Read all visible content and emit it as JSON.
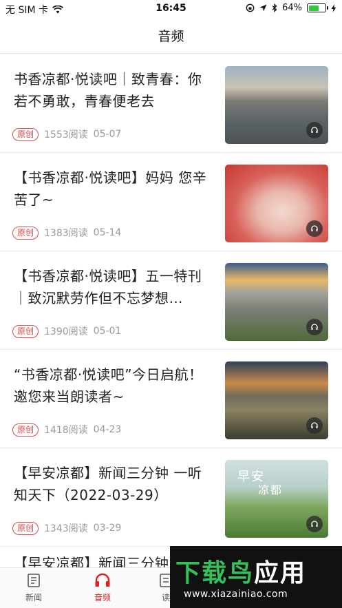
{
  "status": {
    "carrier": "无 SIM 卡",
    "time": "16:45",
    "battery": "64%",
    "battery_level": 0.64
  },
  "nav": {
    "title": "音频"
  },
  "items": [
    {
      "title": "书香凉都·悦读吧｜致青春：你若不勇敢，青春便老去",
      "badge": "原创",
      "reads": "1553阅读",
      "date": "05-07"
    },
    {
      "title": "【书香凉都·悦读吧】妈妈  您辛苦了~",
      "badge": "原创",
      "reads": "1383阅读",
      "date": "05-14"
    },
    {
      "title": "【书香凉都·悦读吧】五一特刊｜致沉默劳作但不忘梦想…",
      "badge": "原创",
      "reads": "1390阅读",
      "date": "05-01"
    },
    {
      "title": "“书香凉都·悦读吧”今日启航！邀您来当朗读者~",
      "badge": "原创",
      "reads": "1418阅读",
      "date": "04-23"
    },
    {
      "title": "【早安凉都】新闻三分钟 一听知天下（2022-03-29）",
      "badge": "原创",
      "reads": "1343阅读",
      "date": "03-29",
      "thumb_text_1": "早安",
      "thumb_text_2": "凉都"
    },
    {
      "title": "【早安凉都】新闻三分钟"
    }
  ],
  "tabs": [
    {
      "label": "新闻",
      "icon": "news-icon"
    },
    {
      "label": "音频",
      "icon": "headphones-icon"
    },
    {
      "label": "读",
      "icon": "read-icon"
    }
  ],
  "watermark": {
    "text": "下载鸟应用",
    "url": "www.xiazainiao.com"
  },
  "colors": {
    "accent": "#d22222",
    "battery": "#2fc940",
    "watermark_green": "#35c15a"
  }
}
